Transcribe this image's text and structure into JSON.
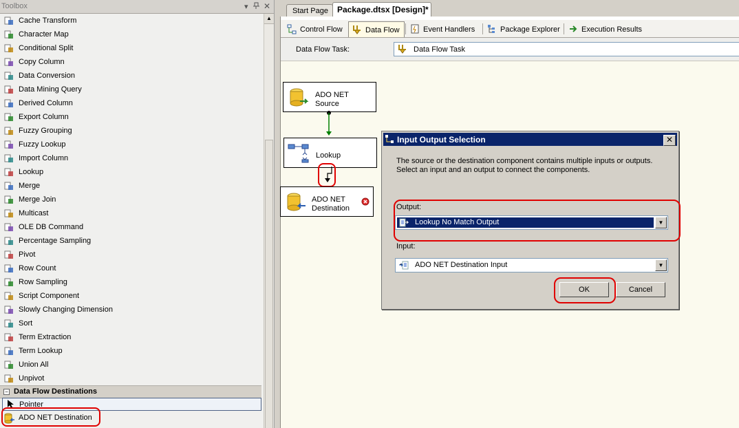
{
  "toolbox": {
    "title": "Toolbox",
    "items": [
      {
        "label": "Cache Transform",
        "icon": "cache-transform-icon"
      },
      {
        "label": "Character Map",
        "icon": "character-map-icon"
      },
      {
        "label": "Conditional Split",
        "icon": "conditional-split-icon"
      },
      {
        "label": "Copy Column",
        "icon": "copy-column-icon"
      },
      {
        "label": "Data Conversion",
        "icon": "data-conversion-icon"
      },
      {
        "label": "Data Mining Query",
        "icon": "data-mining-query-icon"
      },
      {
        "label": "Derived Column",
        "icon": "derived-column-icon"
      },
      {
        "label": "Export Column",
        "icon": "export-column-icon"
      },
      {
        "label": "Fuzzy Grouping",
        "icon": "fuzzy-grouping-icon"
      },
      {
        "label": "Fuzzy Lookup",
        "icon": "fuzzy-lookup-icon"
      },
      {
        "label": "Import Column",
        "icon": "import-column-icon"
      },
      {
        "label": "Lookup",
        "icon": "lookup-icon"
      },
      {
        "label": "Merge",
        "icon": "merge-icon"
      },
      {
        "label": "Merge Join",
        "icon": "merge-join-icon"
      },
      {
        "label": "Multicast",
        "icon": "multicast-icon"
      },
      {
        "label": "OLE DB Command",
        "icon": "ole-db-command-icon"
      },
      {
        "label": "Percentage Sampling",
        "icon": "percentage-sampling-icon"
      },
      {
        "label": "Pivot",
        "icon": "pivot-icon"
      },
      {
        "label": "Row Count",
        "icon": "row-count-icon"
      },
      {
        "label": "Row Sampling",
        "icon": "row-sampling-icon"
      },
      {
        "label": "Script Component",
        "icon": "script-component-icon"
      },
      {
        "label": "Slowly Changing Dimension",
        "icon": "slowly-changing-dimension-icon"
      },
      {
        "label": "Sort",
        "icon": "sort-icon"
      },
      {
        "label": "Term Extraction",
        "icon": "term-extraction-icon"
      },
      {
        "label": "Term Lookup",
        "icon": "term-lookup-icon"
      },
      {
        "label": "Union All",
        "icon": "union-all-icon"
      },
      {
        "label": "Unpivot",
        "icon": "unpivot-icon"
      }
    ],
    "category": {
      "label": "Data Flow Destinations",
      "toggle": "−"
    },
    "pointer": {
      "label": "Pointer"
    },
    "destination_item": {
      "label": "ADO NET Destination"
    }
  },
  "document_tabs": {
    "start_page": "Start Page",
    "active": "Package.dtsx [Design]*"
  },
  "designer_tabs": [
    {
      "label": "Control Flow",
      "icon": "control-flow-icon"
    },
    {
      "label": "Data Flow",
      "icon": "data-flow-icon"
    },
    {
      "label": "Event Handlers",
      "icon": "event-handlers-icon"
    },
    {
      "label": "Package Explorer",
      "icon": "package-explorer-icon"
    },
    {
      "label": "Execution Results",
      "icon": "execution-results-icon"
    }
  ],
  "task_bar": {
    "label": "Data Flow Task:",
    "selected": "Data Flow Task"
  },
  "canvas": {
    "source": {
      "line1": "ADO NET",
      "line2": "Source"
    },
    "lookup": {
      "label": "Lookup"
    },
    "destination": {
      "line1": "ADO NET",
      "line2": "Destination"
    }
  },
  "dialog": {
    "title": "Input Output Selection",
    "close": "✕",
    "description_line1": "The source or the destination component contains multiple inputs or outputs.",
    "description_line2": "Select an input and an output to connect the components.",
    "output_label": "Output:",
    "output_value": "Lookup No Match Output",
    "input_label": "Input:",
    "input_value": "ADO NET Destination Input",
    "ok": "OK",
    "cancel": "Cancel"
  },
  "colors": {
    "highlight_red": "#e00000",
    "selection_blue": "#0a246a",
    "canvas_background": "#fbfaee",
    "arrow_green": "#008000"
  }
}
